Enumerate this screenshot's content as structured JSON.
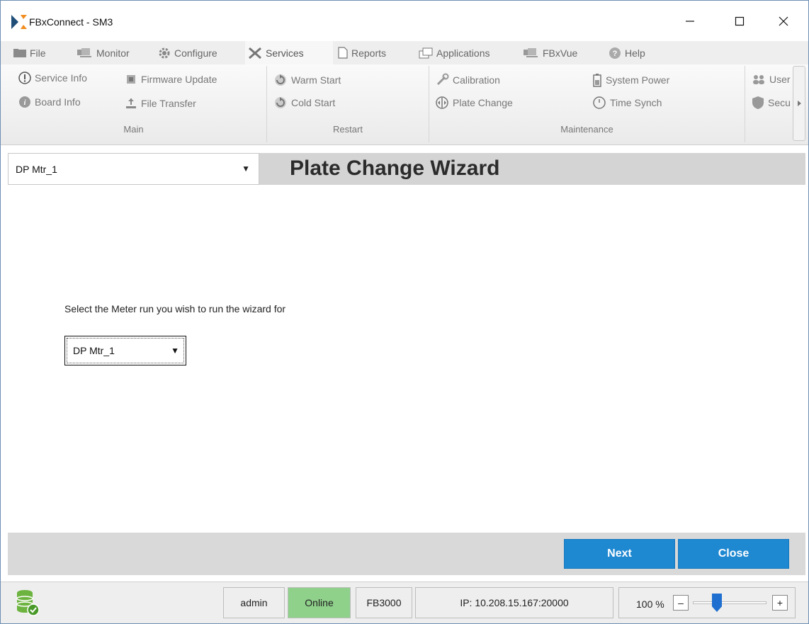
{
  "window": {
    "title": "FBxConnect - SM3",
    "controls": {
      "minimize": "—",
      "maximize": "☐",
      "close": "✕"
    }
  },
  "menu": {
    "tabs": [
      {
        "label": "File",
        "icon": "folder-icon"
      },
      {
        "label": "Monitor",
        "icon": "monitor-icon"
      },
      {
        "label": "Configure",
        "icon": "gear-icon"
      },
      {
        "label": "Services",
        "icon": "tools-icon",
        "active": true
      },
      {
        "label": "Reports",
        "icon": "document-icon"
      },
      {
        "label": "Applications",
        "icon": "windows-icon"
      },
      {
        "label": "FBxVue",
        "icon": "monitor-icon"
      },
      {
        "label": "Help",
        "icon": "help-icon"
      }
    ]
  },
  "ribbon": {
    "service_info": "Service Info",
    "firmware_update": "Firmware Update",
    "board_info": "Board Info",
    "file_transfer": "File Transfer",
    "warm_start": "Warm Start",
    "cold_start": "Cold Start",
    "calibration": "Calibration",
    "plate_change": "Plate Change",
    "system_power": "System Power",
    "time_synch": "Time Synch",
    "users": "User",
    "security": "Secu",
    "groups": {
      "main": "Main",
      "restart": "Restart",
      "maintenance": "Maintenance"
    }
  },
  "header": {
    "meter_value": "DP Mtr_1",
    "title": "Plate Change Wizard"
  },
  "content": {
    "prompt": "Select the Meter run you wish to run the wizard for",
    "run_value": "DP Mtr_1"
  },
  "buttons": {
    "next": "Next",
    "close": "Close"
  },
  "status": {
    "user": "admin",
    "connection": "Online",
    "device": "FB3000",
    "ip": "IP: 10.208.15.167:20000",
    "zoom": "100 %",
    "zoom_minus": "–",
    "zoom_plus": "+",
    "zoom_level_percent": 100
  },
  "colors": {
    "accent": "#1e88d1",
    "online": "#8fd08b",
    "header_band": "#d4d4d4"
  }
}
